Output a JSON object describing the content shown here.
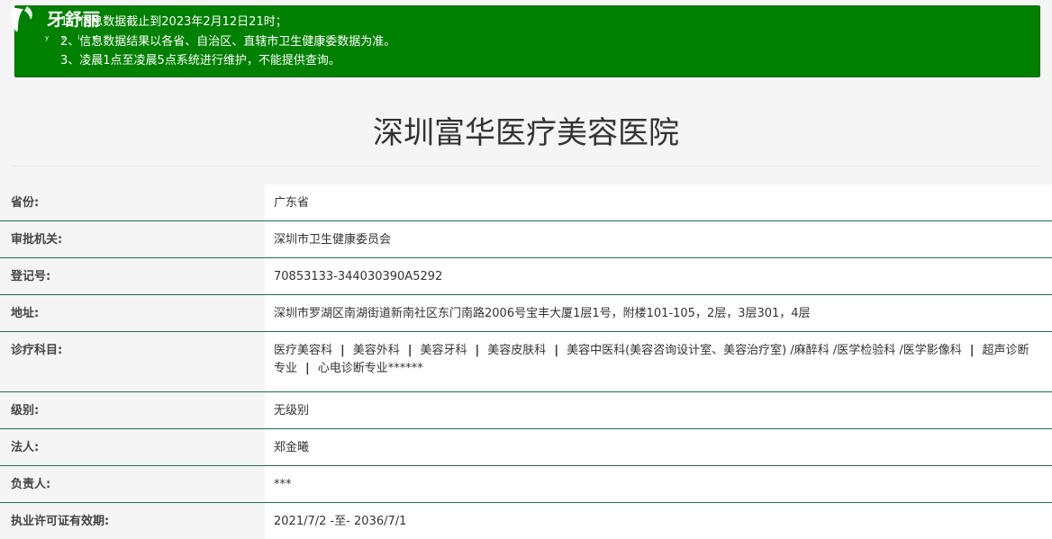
{
  "logo": {
    "text": "牙舒丽",
    "sub": "y s l w"
  },
  "notice": {
    "lines": [
      "1、信息数据截止到2023年2月12日21时；",
      "2、信息数据结果以各省、自治区、直辖市卫生健康委数据为准。",
      "3、凌晨1点至凌晨5点系统进行维护，不能提供查询。"
    ]
  },
  "page": {
    "title": "深圳富华医疗美容医院"
  },
  "details": {
    "province": {
      "label": "省份:",
      "value": "广东省"
    },
    "authority": {
      "label": "审批机关:",
      "value": "深圳市卫生健康委员会"
    },
    "reg_no": {
      "label": "登记号:",
      "value": "70853133-344030390A5292"
    },
    "address": {
      "label": "地址:",
      "value": "深圳市罗湖区南湖街道新南社区东门南路2006号宝丰大厦1层1号，附楼101-105，2层，3层301，4层"
    },
    "departments": {
      "label": "诊疗科目:",
      "items": [
        "医疗美容科",
        "美容外科",
        "美容牙科",
        "美容皮肤科",
        "美容中医科(美容咨询设计室、美容治疗室) /麻醉科 /医学检验科 /医学影像科",
        "超声诊断专业",
        "心电诊断专业******"
      ],
      "separator": "|"
    },
    "level": {
      "label": "级别:",
      "value": "无级别"
    },
    "legal_person": {
      "label": "法人:",
      "value": "郑金曦"
    },
    "person_in_charge": {
      "label": "负责人:",
      "value": "***"
    },
    "license_validity": {
      "label": "执业许可证有效期:",
      "value": "2021/7/2 -至- 2036/7/1"
    }
  },
  "colors": {
    "notice_bg": "#008000",
    "row_border": "#1e6e50",
    "label_bg": "#f5f5f5",
    "value_bg": "#ffffff"
  }
}
